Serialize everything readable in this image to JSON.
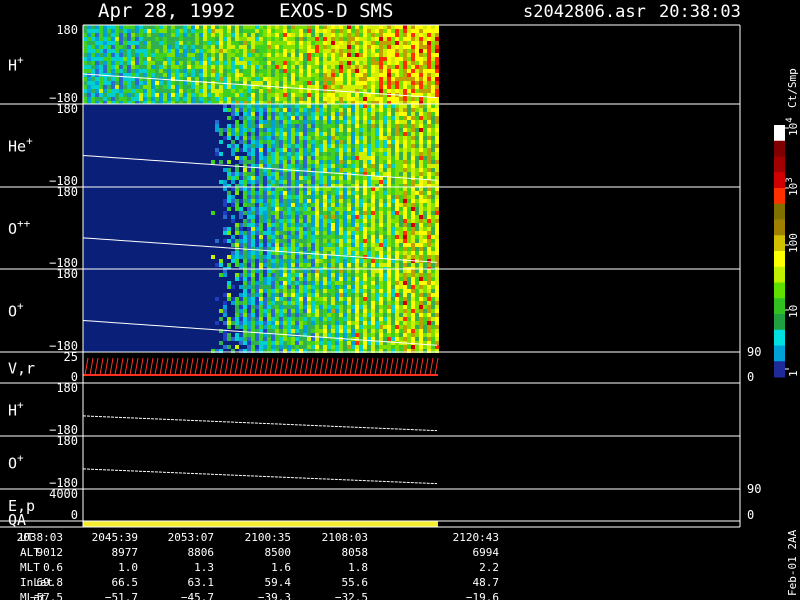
{
  "header": {
    "date": "Apr 28, 1992",
    "instrument": "EXOS-D SMS",
    "file": "s2042806.asr",
    "time": "20:38:03"
  },
  "chart_data": {
    "type": "heatmap",
    "panels": [
      {
        "label": "H",
        "sup": "+",
        "ytop": "180",
        "ybot": "−180",
        "kind": "spectrogram",
        "base": "#0a2a8a"
      },
      {
        "label": "He",
        "sup": "+",
        "ytop": "180",
        "ybot": "−180",
        "kind": "spectrogram",
        "base": "#0a1f78"
      },
      {
        "label": "O",
        "sup": "++",
        "ytop": "180",
        "ybot": "−180",
        "kind": "spectrogram",
        "base": "#0a1f78"
      },
      {
        "label": "O",
        "sup": "+",
        "ytop": "180",
        "ybot": "−180",
        "kind": "spectrogram",
        "base": "#0a1f78"
      },
      {
        "label": "V,r",
        "sup": "",
        "ytop": "25",
        "ybot": "0",
        "kind": "velocity",
        "right_top": "90",
        "right_bot": "0"
      },
      {
        "label": "H",
        "sup": "+",
        "ytop": "180",
        "ybot": "−180",
        "kind": "line"
      },
      {
        "label": "O",
        "sup": "+",
        "ytop": "180",
        "ybot": "−180",
        "kind": "line"
      },
      {
        "label": "E,p",
        "sup": "",
        "ytop": "4000",
        "ybot": "0",
        "kind": "empty",
        "right_top": "90",
        "right_bot": "0"
      },
      {
        "label": "QA",
        "sup": "",
        "ytop": "",
        "ybot": "",
        "kind": "qa"
      }
    ],
    "colorbar": {
      "unit": "Ct/Smp",
      "tick_labels": [
        "1",
        "10",
        "100",
        "10",
        "10"
      ],
      "tick_sups": [
        "",
        "",
        "",
        "3",
        "4"
      ],
      "colors": [
        "#1f2a9a",
        "#00a0d8",
        "#00e0e0",
        "#20a040",
        "#30c020",
        "#60e000",
        "#c0f000",
        "#ffff00",
        "#d0c000",
        "#a08000",
        "#807000",
        "#ff3000",
        "#d00000",
        "#a00000",
        "#800000",
        "#ffffff"
      ]
    },
    "orbit_table": {
      "rows": [
        {
          "name": "UT",
          "values": [
            "2038:03",
            "2045:39",
            "2053:07",
            "2100:35",
            "2108:03",
            "2120:43"
          ]
        },
        {
          "name": "ALT",
          "values": [
            "9012",
            "8977",
            "8806",
            "8500",
            "8058",
            "6994"
          ]
        },
        {
          "name": "MLT",
          "values": [
            "0.6",
            "1.0",
            "1.3",
            "1.6",
            "1.8",
            "2.2"
          ]
        },
        {
          "name": "InLat",
          "values": [
            "69.8",
            "66.5",
            "63.1",
            "59.4",
            "55.6",
            "48.7"
          ]
        },
        {
          "name": "MLat",
          "values": [
            "−57.5",
            "−51.7",
            "−45.7",
            "−39.3",
            "−32.5",
            "−19.6"
          ]
        }
      ]
    },
    "footer_label": "Feb-01 2AA",
    "data_coverage_fraction": 0.54,
    "data_onset_fraction": 0.22
  }
}
